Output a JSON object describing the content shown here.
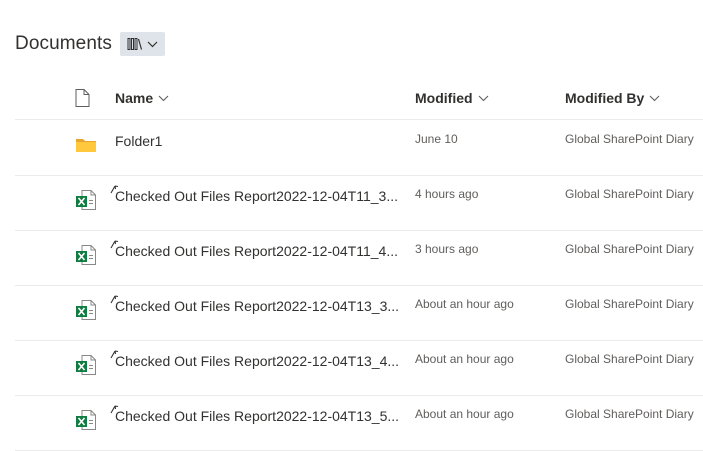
{
  "page": {
    "title": "Documents"
  },
  "view_switcher": {
    "icon": "library-icon"
  },
  "columns": {
    "name": "Name",
    "modified": "Modified",
    "modified_by": "Modified By"
  },
  "files": [
    {
      "type": "folder",
      "icon": "folder-icon",
      "name": "Folder1",
      "modified": "June 10",
      "modified_by": "Global SharePoint Diary",
      "checked_out": false
    },
    {
      "type": "excel",
      "icon": "excel-icon",
      "name": "Checked Out Files Report2022-12-04T11_3...",
      "modified": "4 hours ago",
      "modified_by": "Global SharePoint Diary",
      "checked_out": true
    },
    {
      "type": "excel",
      "icon": "excel-icon",
      "name": "Checked Out Files Report2022-12-04T11_4...",
      "modified": "3 hours ago",
      "modified_by": "Global SharePoint Diary",
      "checked_out": true
    },
    {
      "type": "excel",
      "icon": "excel-icon",
      "name": "Checked Out Files Report2022-12-04T13_3...",
      "modified": "About an hour ago",
      "modified_by": "Global SharePoint Diary",
      "checked_out": true
    },
    {
      "type": "excel",
      "icon": "excel-icon",
      "name": "Checked Out Files Report2022-12-04T13_4...",
      "modified": "About an hour ago",
      "modified_by": "Global SharePoint Diary",
      "checked_out": true
    },
    {
      "type": "excel",
      "icon": "excel-icon",
      "name": "Checked Out Files Report2022-12-04T13_5...",
      "modified": "About an hour ago",
      "modified_by": "Global SharePoint Diary",
      "checked_out": true
    }
  ],
  "colors": {
    "folder": "#ffc83d",
    "excel": "#107c41",
    "view_button_bg": "#dfe3ea"
  }
}
